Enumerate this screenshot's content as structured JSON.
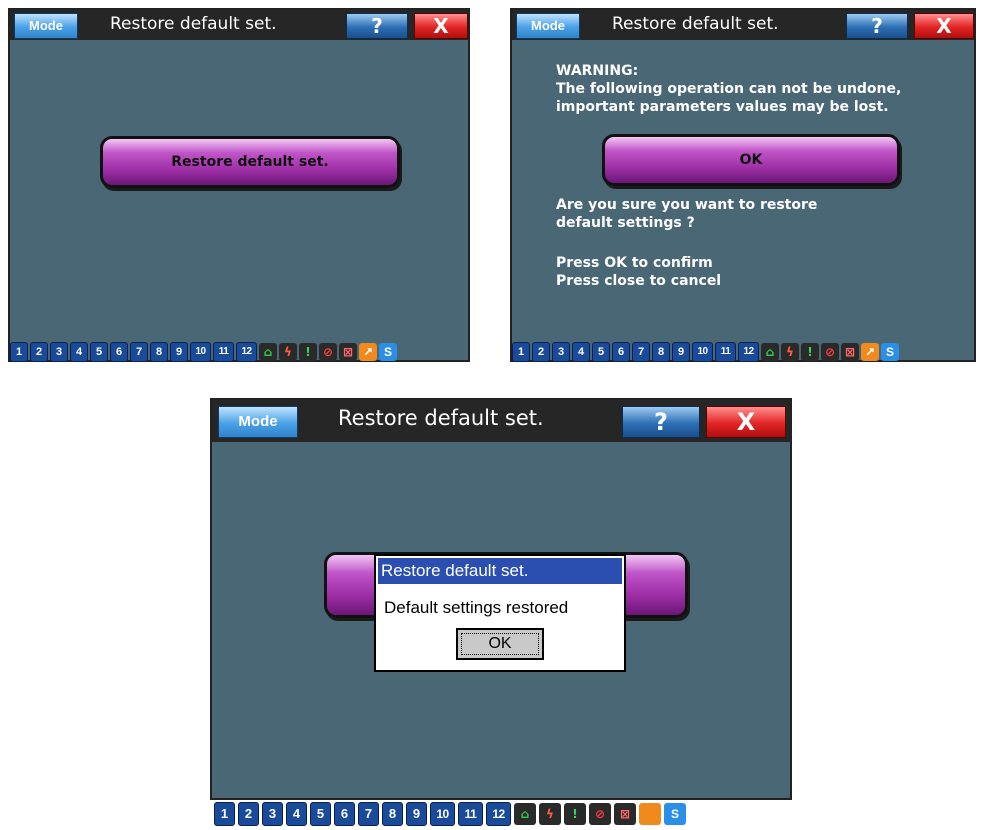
{
  "screens": [
    {
      "mode_label": "Mode",
      "title": "Restore default set.",
      "help_label": "?",
      "close_label": "X",
      "action_button_label": "Restore default set."
    },
    {
      "mode_label": "Mode",
      "title": "Restore default set.",
      "help_label": "?",
      "close_label": "X",
      "warning_lines": [
        "WARNING:",
        "The following operation can not be undone,",
        "important parameters values may be lost."
      ],
      "ok_label": "OK",
      "question_lines": [
        "Are you sure you want to restore",
        "default settings ?"
      ],
      "instruction_lines": [
        "Press OK to confirm",
        "Press close to cancel"
      ]
    },
    {
      "mode_label": "Mode",
      "title": "Restore default set.",
      "help_label": "?",
      "close_label": "X",
      "dialog": {
        "title": "Restore default set.",
        "message": "Default settings restored",
        "ok_label": "OK"
      }
    }
  ],
  "bottom_bar": {
    "numbers": [
      "1",
      "2",
      "3",
      "4",
      "5",
      "6",
      "7",
      "8",
      "9",
      "10",
      "11",
      "12"
    ],
    "icons": [
      "lock-icon",
      "lightning-icon",
      "thermometer-icon",
      "no-entry-icon",
      "no-document-icon",
      "arrow-icon",
      "s-icon"
    ],
    "s_label": "S"
  },
  "colors": {
    "screen_bg": "#4a6775",
    "titlebar_bg": "#262626",
    "action_button": "#a030a8",
    "dialog_title_bg": "#2a4fb0"
  }
}
